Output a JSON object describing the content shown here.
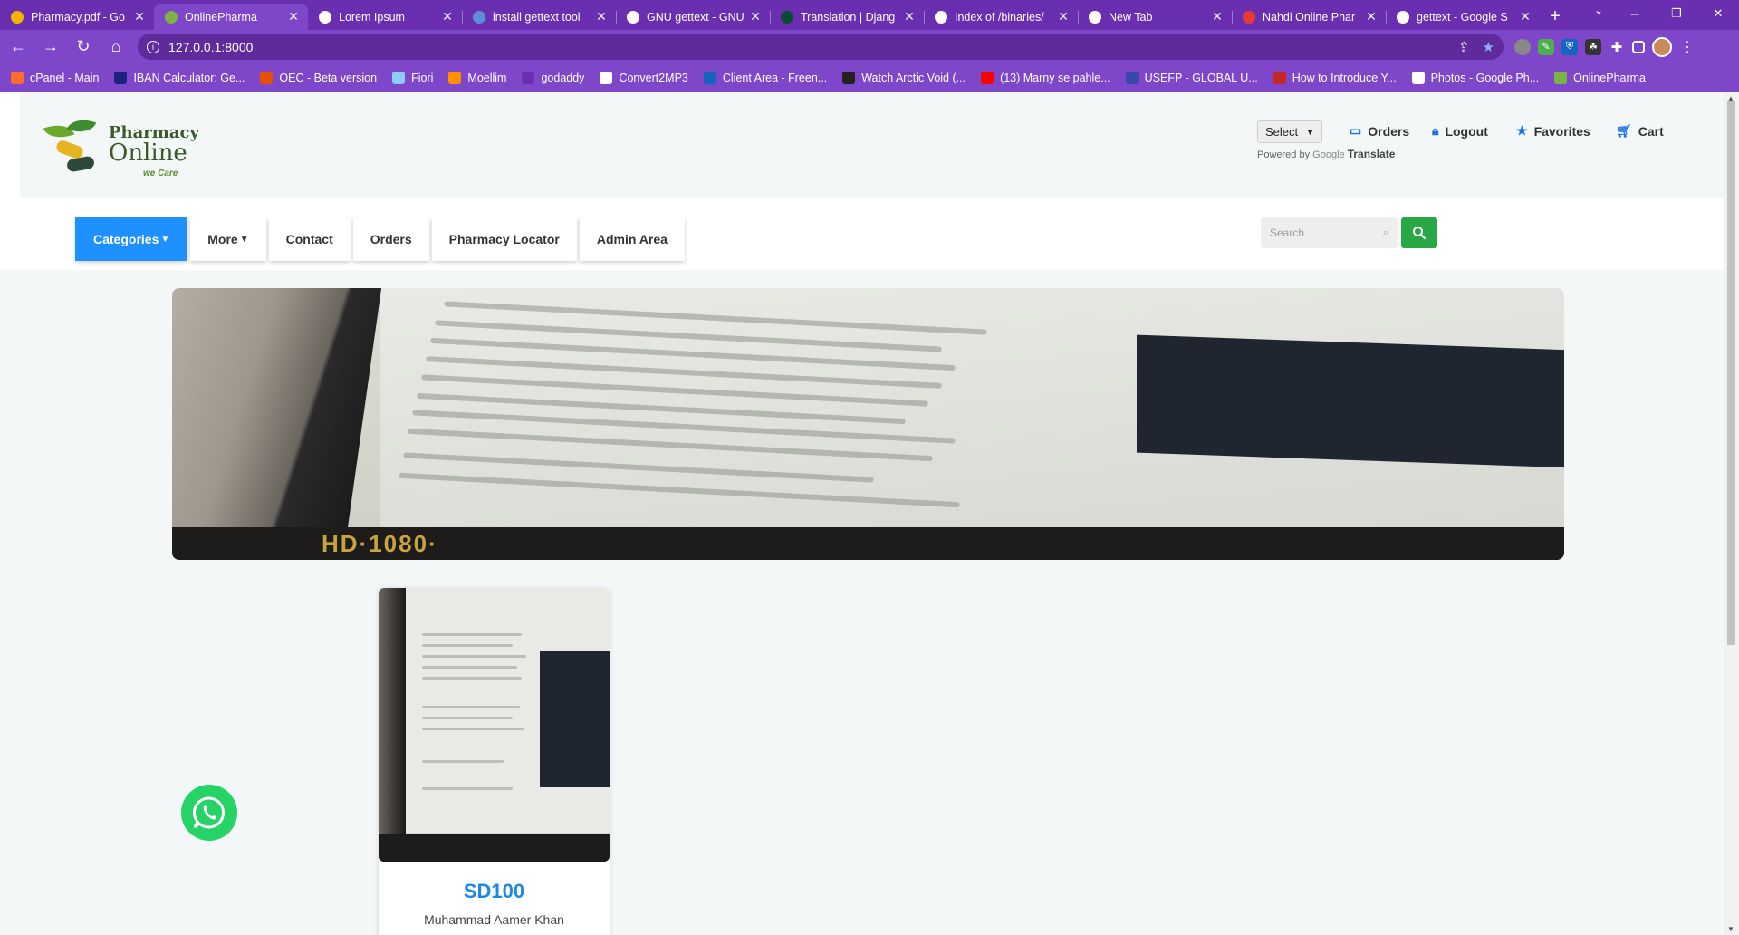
{
  "browser": {
    "tabs": [
      {
        "title": "Pharmacy.pdf - Go",
        "icon": "google-drive-icon",
        "color": "#f4b400",
        "active": false
      },
      {
        "title": "OnlinePharma",
        "icon": "pharmacy-icon",
        "color": "#7cb342",
        "active": true
      },
      {
        "title": "Lorem Ipsum",
        "icon": "globe-icon",
        "color": "#ffffff",
        "active": false
      },
      {
        "title": "install gettext tool",
        "icon": "stackexchange-icon",
        "color": "#5b8fd6",
        "active": false
      },
      {
        "title": "GNU gettext - GNU",
        "icon": "gnu-icon",
        "color": "#ffffff",
        "active": false
      },
      {
        "title": "Translation | Djang",
        "icon": "django-icon",
        "color": "#0c4b33",
        "active": false
      },
      {
        "title": "Index of /binaries/",
        "icon": "globe-icon",
        "color": "#ffffff",
        "active": false
      },
      {
        "title": "New Tab",
        "icon": "chrome-icon",
        "color": "#ffffff",
        "active": false
      },
      {
        "title": "Nahdi Online Phar",
        "icon": "nahdi-icon",
        "color": "#e53935",
        "active": false
      },
      {
        "title": "gettext - Google S",
        "icon": "google-icon",
        "color": "#ffffff",
        "active": false
      }
    ],
    "url": "127.0.0.1:8000",
    "bookmarks": [
      {
        "label": "cPanel - Main",
        "color": "#ff6c2c"
      },
      {
        "label": "IBAN Calculator: Ge...",
        "color": "#1a237e"
      },
      {
        "label": "OEC - Beta version",
        "color": "#e65100"
      },
      {
        "label": "Fiori",
        "color": "#90caf9"
      },
      {
        "label": "Moellim",
        "color": "#ff8f00"
      },
      {
        "label": "godaddy",
        "color": "#6a2fb0"
      },
      {
        "label": "Convert2MP3",
        "color": "#ffffff"
      },
      {
        "label": "Client Area - Freen...",
        "color": "#1565c0"
      },
      {
        "label": "Watch Arctic Void (...",
        "color": "#212121"
      },
      {
        "label": "(13) Marny se pahle...",
        "color": "#ff0000"
      },
      {
        "label": "USEFP - GLOBAL U...",
        "color": "#3949ab"
      },
      {
        "label": "How to Introduce Y...",
        "color": "#c62828"
      },
      {
        "label": "Photos - Google Ph...",
        "color": "#ffffff"
      },
      {
        "label": "OnlinePharma",
        "color": "#7cb342"
      }
    ]
  },
  "header": {
    "logo": {
      "line1": "Pharmacy",
      "line2": "Online",
      "tagline": "we Care"
    },
    "language_select": "Select",
    "powered_by": "Powered by",
    "google": "Google",
    "translate": "Translate",
    "links": [
      {
        "label": "Orders",
        "icon": "orders-icon"
      },
      {
        "label": "Logout",
        "icon": "lock-icon"
      },
      {
        "label": "Favorites",
        "icon": "star-icon"
      },
      {
        "label": "Cart",
        "icon": "cart-icon"
      }
    ]
  },
  "nav": {
    "categories": "Categories",
    "more": "More",
    "contact": "Contact",
    "orders": "Orders",
    "locator": "Pharmacy Locator",
    "admin": "Admin Area"
  },
  "search": {
    "placeholder": "Search"
  },
  "product": {
    "title": "SD100",
    "author": "Muhammad Aamer Khan"
  },
  "colors": {
    "accent": "#1e90ff",
    "search_button": "#28a745",
    "product_title": "#1e88e5",
    "browser": "#7e47c9"
  }
}
